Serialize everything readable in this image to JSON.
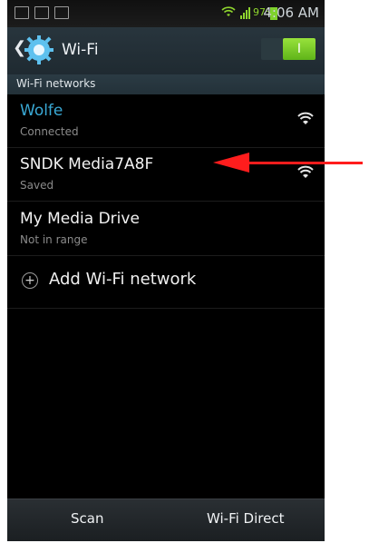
{
  "status_bar": {
    "time": "4:06 AM",
    "battery_percent": "97%"
  },
  "header": {
    "title": "Wi-Fi",
    "toggle_label": "I"
  },
  "section": {
    "title": "Wi-Fi networks"
  },
  "networks": [
    {
      "name": "Wolfe",
      "status": "Connected"
    },
    {
      "name": "SNDK Media7A8F",
      "status": "Saved"
    },
    {
      "name": "My Media Drive",
      "status": "Not in range"
    }
  ],
  "actions": {
    "add_network": "Add Wi-Fi network"
  },
  "bottom_bar": {
    "scan": "Scan",
    "wifi_direct": "Wi-Fi Direct"
  },
  "colors": {
    "accent": "#3aa9d5",
    "toggle_on": "#7fd22d",
    "annotation": "#ff1d1d"
  }
}
